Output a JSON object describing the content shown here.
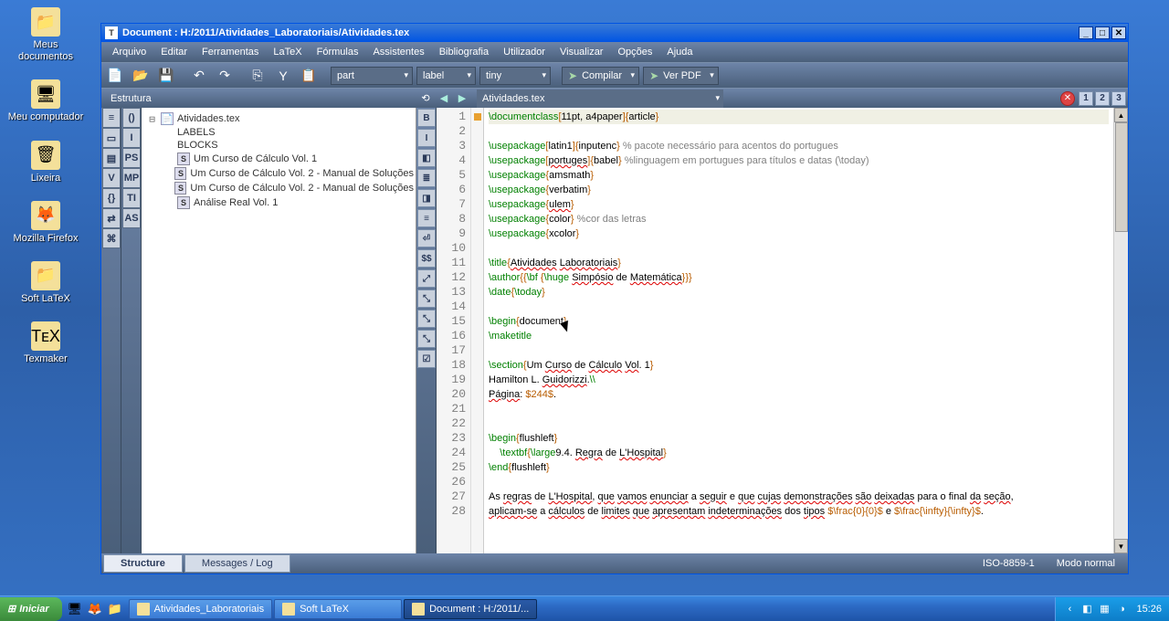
{
  "desktop": {
    "icons": [
      {
        "label": "Meus documentos",
        "glyph": "📁"
      },
      {
        "label": "Meu computador",
        "glyph": "🖥"
      },
      {
        "label": "Lixeira",
        "glyph": "🗑"
      },
      {
        "label": "Mozilla Firefox",
        "glyph": "🦊"
      },
      {
        "label": "Soft LaTeX",
        "glyph": "📁"
      },
      {
        "label": "Texmaker",
        "glyph": "TᴇX"
      }
    ]
  },
  "window": {
    "title": "Document : H:/2011/Atividades_Laboratoriais/Atividades.tex",
    "menu": [
      "Arquivo",
      "Editar",
      "Ferramentas",
      "LaTeX",
      "Fórmulas",
      "Assistentes",
      "Bibliografia",
      "Utilizador",
      "Visualizar",
      "Opções",
      "Ajuda"
    ],
    "combos": {
      "section": "part",
      "ref": "label",
      "size": "tiny"
    },
    "actions": {
      "compile": "Compilar",
      "view": "Ver PDF"
    },
    "structure_label": "Estrutura",
    "active_tab": "Atividades.tex",
    "num_pills": [
      "1",
      "2",
      "3"
    ],
    "tree": [
      {
        "indent": 0,
        "toggle": "⊟",
        "icon": "doc",
        "label": "Atividades.tex"
      },
      {
        "indent": 1,
        "toggle": "",
        "icon": "",
        "label": "LABELS"
      },
      {
        "indent": 1,
        "toggle": "",
        "icon": "",
        "label": "BLOCKS"
      },
      {
        "indent": 1,
        "toggle": "",
        "icon": "s",
        "label": "Um Curso de Cálculo Vol. 1"
      },
      {
        "indent": 1,
        "toggle": "",
        "icon": "s",
        "label": "Um Curso de Cálculo Vol. 2 - Manual de Soluções"
      },
      {
        "indent": 1,
        "toggle": "",
        "icon": "s",
        "label": "Um Curso de Cálculo Vol. 2 - Manual de Soluções"
      },
      {
        "indent": 1,
        "toggle": "",
        "icon": "s",
        "label": "Análise Real Vol. 1"
      }
    ],
    "leftstrip": [
      "≡",
      "▭",
      "▤",
      "V",
      "{}",
      "⇄",
      "⌘",
      "()",
      "I",
      "PS",
      "MP",
      "TI",
      "AS"
    ],
    "midstrip": [
      "B",
      "I",
      "◧",
      "≣",
      "◨",
      "≡",
      "⏎",
      "$$",
      "⤢",
      "⤡",
      "⤡",
      "⤡",
      "☑"
    ],
    "code_lines": [
      {
        "n": 1,
        "current": true,
        "html": "<span class='cmd'>\\documentclass</span><span class='brk'>[</span>11pt, a4paper<span class='brk'>]</span><span class='brk'>{</span>article<span class='brk'>}</span>"
      },
      {
        "n": 2,
        "html": ""
      },
      {
        "n": 3,
        "html": "<span class='cmd'>\\usepackage</span><span class='brk'>[</span>latin1<span class='brk'>]</span><span class='brk'>{</span>inputenc<span class='brk'>}</span> <span class='cmt'>% pacote necessário para acentos do portugues</span>"
      },
      {
        "n": 4,
        "html": "<span class='cmd'>\\usepackage</span><span class='brk'>[</span><span class='wavy'>portuges</span><span class='brk'>]</span><span class='brk'>{</span>babel<span class='brk'>}</span> <span class='cmt'>%linguagem em portugues para títulos e datas (\\today)</span>"
      },
      {
        "n": 5,
        "html": "<span class='cmd'>\\usepackage</span><span class='brk'>{</span>amsmath<span class='brk'>}</span>"
      },
      {
        "n": 6,
        "html": "<span class='cmd'>\\usepackage</span><span class='brk'>{</span>verbatim<span class='brk'>}</span>"
      },
      {
        "n": 7,
        "html": "<span class='cmd'>\\usepackage</span><span class='brk'>{</span><span class='wavy'>ulem</span><span class='brk'>}</span>"
      },
      {
        "n": 8,
        "html": "<span class='cmd'>\\usepackage</span><span class='brk'>{</span>color<span class='brk'>}</span> <span class='cmt'>%cor das letras</span>"
      },
      {
        "n": 9,
        "html": "<span class='cmd'>\\usepackage</span><span class='brk'>{</span>xcolor<span class='brk'>}</span>"
      },
      {
        "n": 10,
        "html": ""
      },
      {
        "n": 11,
        "html": "<span class='cmd'>\\title</span><span class='brk'>{</span><span class='wavy'>Atividades</span> <span class='wavy'>Laboratoriais</span><span class='brk'>}</span>"
      },
      {
        "n": 12,
        "html": "<span class='cmd'>\\author</span><span class='brk'>{</span><span class='brk'>{</span><span class='cmd'>\\bf</span> <span class='brk'>{</span><span class='cmd'>\\huge</span> <span class='wavy'>Simpósio</span> de <span class='wavy'>Matemática</span><span class='brk'>}</span><span class='brk'>}</span><span class='brk'>}</span>"
      },
      {
        "n": 13,
        "html": "<span class='cmd'>\\date</span><span class='brk'>{</span><span class='cmd'>\\today</span><span class='brk'>}</span>"
      },
      {
        "n": 14,
        "html": ""
      },
      {
        "n": 15,
        "html": "<span class='cmd'>\\begin</span><span class='brk'>{</span>document<span class='brk'>}</span>"
      },
      {
        "n": 16,
        "html": "<span class='cmd'>\\maketitle</span>"
      },
      {
        "n": 17,
        "html": ""
      },
      {
        "n": 18,
        "html": "<span class='cmd'>\\section</span><span class='brk'>{</span>Um <span class='wavy'>Curso</span> de <span class='wavy'>Cálculo</span> <span class='wavy'>Vol</span>. 1<span class='brk'>}</span>"
      },
      {
        "n": 19,
        "html": "Hamilton L. <span class='wavy'>Guidorizzi</span>.<span class='cmd'>\\\\</span>"
      },
      {
        "n": 20,
        "html": "<span class='wavy'>Página</span>: <span class='str'>$244$</span>."
      },
      {
        "n": 21,
        "html": ""
      },
      {
        "n": 22,
        "html": ""
      },
      {
        "n": 23,
        "html": "<span class='cmd'>\\begin</span><span class='brk'>{</span>flushleft<span class='brk'>}</span>"
      },
      {
        "n": 24,
        "html": "    <span class='cmd'>\\textbf</span><span class='brk'>{</span><span class='cmd'>\\large</span>9.4. <span class='wavy'>Regra</span> de <span class='wavy'>L'Hospital</span><span class='brk'>}</span>"
      },
      {
        "n": 25,
        "html": "<span class='cmd'>\\end</span><span class='brk'>{</span>flushleft<span class='brk'>}</span>"
      },
      {
        "n": 26,
        "html": ""
      },
      {
        "n": 27,
        "html": "As <span class='wavy'>regras</span> de <span class='wavy'>L'Hospital</span>, <span class='wavy'>que</span> <span class='wavy'>vamos</span> <span class='wavy'>enunciar</span> a <span class='wavy'>seguir</span> e <span class='wavy'>que</span> <span class='wavy'>cujas</span> <span class='wavy'>demonstrações</span> <span class='wavy'>são</span> <span class='wavy'>deixadas</span> para o final <span class='wavy'>da</span> <span class='wavy'>seção</span>,"
      },
      {
        "n": 28,
        "html": "<span class='wavy'>aplicam-se</span> a <span class='wavy'>cálculos</span> de <span class='wavy'>limites</span> <span class='wavy'>que</span> <span class='wavy'>apresentam</span> <span class='wavy'>indeterminações</span> dos <span class='wavy'>tipos</span> <span class='str'>$\\frac{0}{0}$</span> e <span class='str'>$\\frac{\\infty}{\\infty}$</span>."
      }
    ],
    "bottom_tabs": [
      "Structure",
      "Messages / Log"
    ],
    "status": {
      "encoding": "ISO-8859-1",
      "mode": "Modo normal"
    }
  },
  "taskbar": {
    "start": "Iniciar",
    "buttons": [
      {
        "label": "Atividades_Laboratoriais",
        "active": false
      },
      {
        "label": "Soft LaTeX",
        "active": false
      },
      {
        "label": "Document : H:/2011/...",
        "active": true
      }
    ],
    "clock": "15:26"
  }
}
